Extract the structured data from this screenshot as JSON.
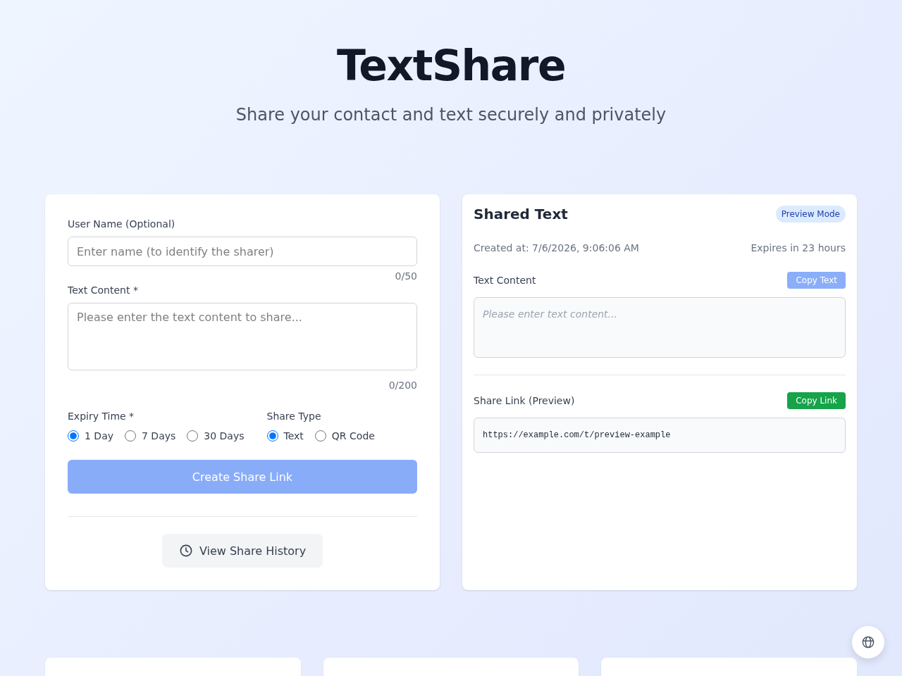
{
  "header": {
    "title": "TextShare",
    "subtitle": "Share your contact and text securely and privately"
  },
  "share_form": {
    "fields": [
      {
        "kind": "input",
        "label": "User Name (Optional)",
        "placeholder": "Enter name (to identify the sharer)",
        "counter": "0/50"
      },
      {
        "kind": "textarea",
        "label": "Text Content *",
        "placeholder": "Please enter the text content to share...",
        "counter": "0/200"
      }
    ],
    "option_groups": [
      {
        "label": "Expiry Time *",
        "options": [
          {
            "label": "1 Day",
            "selected": true
          },
          {
            "label": "7 Days",
            "selected": false
          },
          {
            "label": "30 Days",
            "selected": false
          }
        ]
      },
      {
        "label": "Share Type",
        "options": [
          {
            "label": "Text",
            "selected": true
          },
          {
            "label": "QR Code",
            "selected": false
          }
        ]
      }
    ],
    "submit_button": {
      "label": "Create Share Link",
      "disabled": true
    },
    "history_button": {
      "label": "View Share History"
    }
  },
  "preview": {
    "title": "Shared Text",
    "badge": "Preview Mode",
    "created": "Created at: 7/6/2026, 9:06:06 AM",
    "expires": "Expires in 23 hours",
    "sections": [
      {
        "kind": "text",
        "label": "Text Content",
        "button": {
          "label": "Copy Text",
          "disabled": true
        },
        "empty_text": "Please enter text content..."
      },
      {
        "kind": "link",
        "label": "Share Link (Preview)",
        "button": {
          "label": "Copy Link",
          "disabled": false
        },
        "value": "https://example.com/t/preview-example"
      }
    ]
  }
}
